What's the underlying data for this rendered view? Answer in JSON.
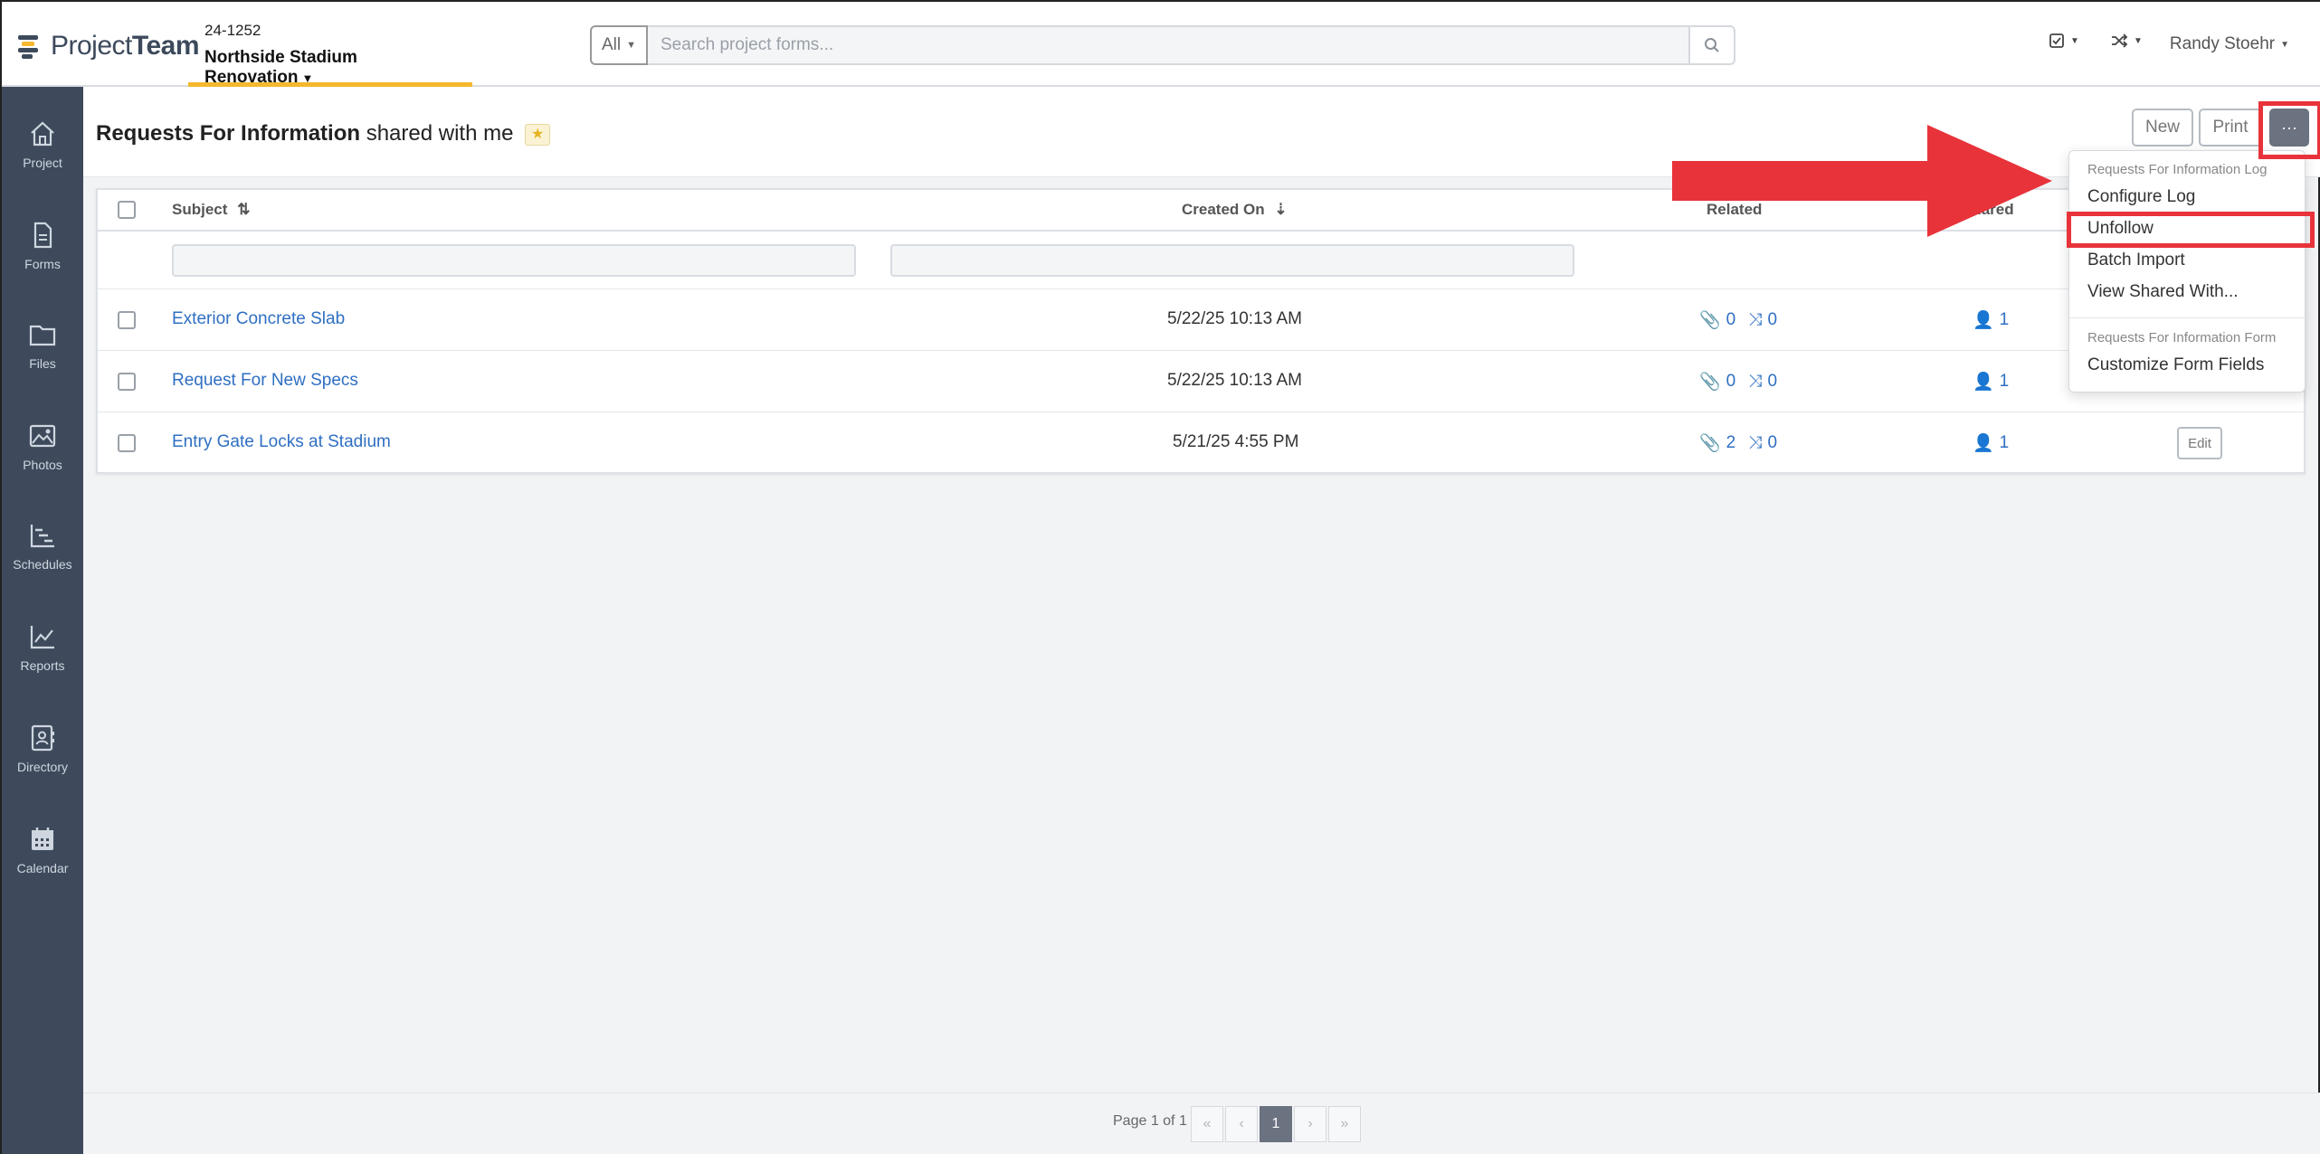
{
  "header": {
    "logo_text_light": "Project",
    "logo_text_bold": "Team",
    "project_number": "24-1252",
    "project_name": "Northside Stadium Renovation",
    "search_scope": "All",
    "search_placeholder": "Search project forms...",
    "user_name": "Randy Stoehr"
  },
  "sidebar": {
    "items": [
      {
        "label": "Project",
        "icon": "home-icon"
      },
      {
        "label": "Forms",
        "icon": "document-icon"
      },
      {
        "label": "Files",
        "icon": "folder-icon"
      },
      {
        "label": "Photos",
        "icon": "image-icon"
      },
      {
        "label": "Schedules",
        "icon": "gantt-icon"
      },
      {
        "label": "Reports",
        "icon": "line-chart-icon"
      },
      {
        "label": "Directory",
        "icon": "contact-book-icon"
      },
      {
        "label": "Calendar",
        "icon": "calendar-icon"
      }
    ]
  },
  "page": {
    "title_strong": "Requests For Information",
    "title_rest": "shared with me",
    "new_label": "New",
    "print_label": "Print",
    "more_label": "···"
  },
  "table": {
    "columns": {
      "subject": "Subject",
      "created_on": "Created On",
      "related": "Related",
      "shared": "Shared"
    },
    "rows": [
      {
        "subject": "Exterior Concrete Slab",
        "created_on": "5/22/25 10:13 AM",
        "attachments": "0",
        "links": "0",
        "shared": "1"
      },
      {
        "subject": "Request For New Specs",
        "created_on": "5/22/25 10:13 AM",
        "attachments": "0",
        "links": "0",
        "shared": "1"
      },
      {
        "subject": "Entry Gate Locks at Stadium",
        "created_on": "5/21/25 4:55 PM",
        "attachments": "2",
        "links": "0",
        "shared": "1",
        "action": "Edit"
      }
    ]
  },
  "dropdown": {
    "log_header": "Requests For Information Log",
    "configure_log": "Configure Log",
    "unfollow": "Unfollow",
    "batch_import": "Batch Import",
    "view_shared_with": "View Shared With...",
    "form_header": "Requests For Information Form",
    "customize_form_fields": "Customize Form Fields"
  },
  "pager": {
    "label": "Page 1 of 1",
    "first": "«",
    "prev": "‹",
    "current": "1",
    "next": "›",
    "last": "»"
  },
  "colors": {
    "sidebar_bg": "#3e4a5c",
    "accent_yellow": "#f5b82e",
    "link_blue": "#2f6fc2",
    "highlight_red": "#e8333b"
  }
}
